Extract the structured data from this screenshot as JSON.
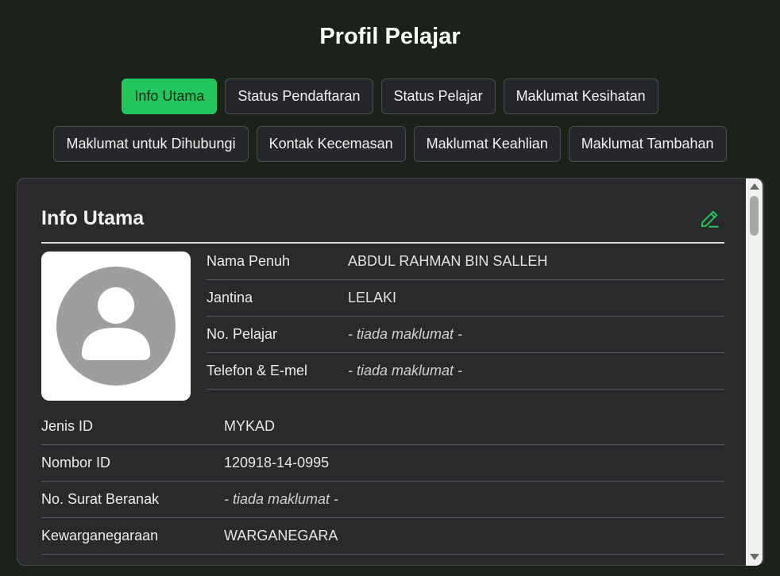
{
  "page": {
    "title": "Profil Pelajar"
  },
  "tabs": [
    {
      "label": "Info Utama",
      "active": true
    },
    {
      "label": "Status Pendaftaran",
      "active": false
    },
    {
      "label": "Status Pelajar",
      "active": false
    },
    {
      "label": "Maklumat Kesihatan",
      "active": false
    },
    {
      "label": "Maklumat untuk Dihubungi",
      "active": false
    },
    {
      "label": "Kontak Kecemasan",
      "active": false
    },
    {
      "label": "Maklumat Keahlian",
      "active": false
    },
    {
      "label": "Maklumat Tambahan",
      "active": false
    }
  ],
  "panel": {
    "title": "Info Utama",
    "edit_icon": "pencil-icon",
    "avatar_icon": "user-avatar-icon",
    "info_rows": [
      {
        "label": "Nama Penuh",
        "value": "ABDUL RAHMAN BIN SALLEH"
      },
      {
        "label": "Jantina",
        "value": "LELAKI"
      },
      {
        "label": "No. Pelajar",
        "value": "- tiada maklumat -"
      },
      {
        "label": "Telefon & E-mel",
        "value": "- tiada maklumat -"
      }
    ],
    "id_rows": [
      {
        "label": "Jenis ID",
        "value": "MYKAD"
      },
      {
        "label": "Nombor ID",
        "value": "120918-14-0995"
      },
      {
        "label": "No. Surat Beranak",
        "value": "- tiada maklumat -"
      },
      {
        "label": "Kewarganegaraan",
        "value": "WARGANEGARA"
      }
    ]
  },
  "colors": {
    "background": "#1b2219",
    "accent": "#22c55e",
    "panel": "#2a2a2d",
    "tab": "#26272b"
  }
}
